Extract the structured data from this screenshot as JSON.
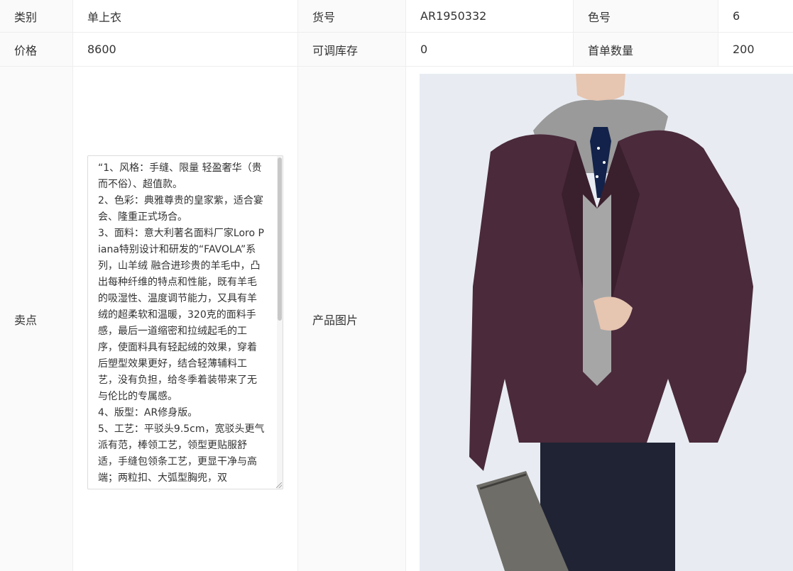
{
  "table": {
    "row1": {
      "label1": "类别",
      "value1": "单上衣",
      "label2": "货号",
      "value2": "AR1950332",
      "label3": "色号",
      "value3": "6"
    },
    "row2": {
      "label1": "价格",
      "value1": "8600",
      "label2": "可调库存",
      "value2": "0",
      "label3": "首单数量",
      "value3": "200"
    },
    "row3": {
      "label_selling_points": "卖点",
      "label_product_image": "产品图片",
      "selling_points_text": "“1、风格：手缝、限量 轻盈奢华（贵而不俗）、超值款。\n2、色彩：典雅尊贵的皇家紫，适合宴会、隆重正式场合。\n3、面料：意大利著名面料厂家Loro Piana特别设计和研发的“FAVOLA”系列，山羊绒 融合进珍贵的羊毛中，凸出每种纤维的特点和性能，既有羊毛的吸湿性、温度调节能力，又具有羊绒的超柔软和温暖，320克的面料手感，最后一道缩密和拉绒起毛的工序，使面料具有轻起绒的效果，穿着后塑型效果更好，结合轻薄辅料工艺，没有负担，给冬季着装带来了无与伦比的专属感。\n4、版型：AR修身版。\n5、工艺：平驳头9.5cm，宽驳头更气派有范，棒领工艺，领型更贴服舒适，手缝包领条工艺，更显干净与高端；两粒扣、大弧型胸兜，双"
    }
  },
  "colors": {
    "label_bg": "#fafafa",
    "border": "#eeeeee",
    "jacket": "#4a2a3b",
    "hoodie": "#9a9a9a",
    "pants": "#1f2333",
    "clutch": "#6f6d68"
  }
}
